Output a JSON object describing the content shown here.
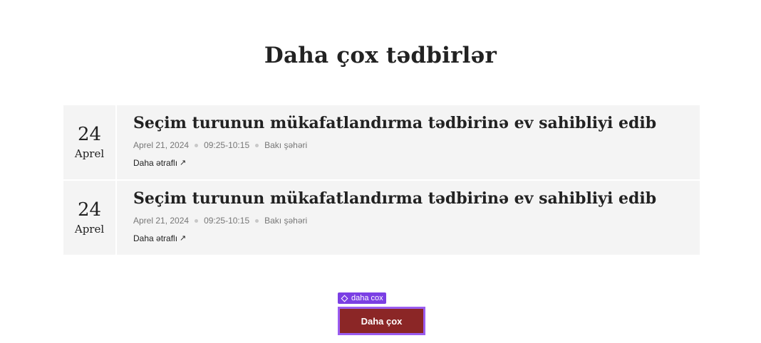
{
  "section": {
    "title": "Daha çox tədbirlər"
  },
  "events": [
    {
      "day": "24",
      "month": "Aprel",
      "title": "Seçim turunun mükafatlandırma tədbirinə ev sahibliyi edib",
      "date": "Aprel 21, 2024",
      "time": "09:25-10:15",
      "location": "Bakı şəhəri",
      "link_label": "Daha ətraflı",
      "link_icon": "arrow-up-right-icon"
    },
    {
      "day": "24",
      "month": "Aprel",
      "title": "Seçim turunun mükafatlandırma tədbirinə ev sahibliyi edib",
      "date": "Aprel 21, 2024",
      "time": "09:25-10:15",
      "location": "Bakı şəhəri",
      "link_label": "Daha ətraflı",
      "link_icon": "arrow-up-right-icon"
    }
  ],
  "component_tag": {
    "label": "daha cox",
    "icon": "component-diamond-icon",
    "color": "#7b3fe4"
  },
  "more_button": {
    "label": "Daha çox",
    "background": "#8b2626",
    "selection_outline": "#9b5cf0"
  },
  "colors": {
    "card_background": "#f4f4f4",
    "meta_text": "#777777",
    "heading_text": "#222222"
  }
}
